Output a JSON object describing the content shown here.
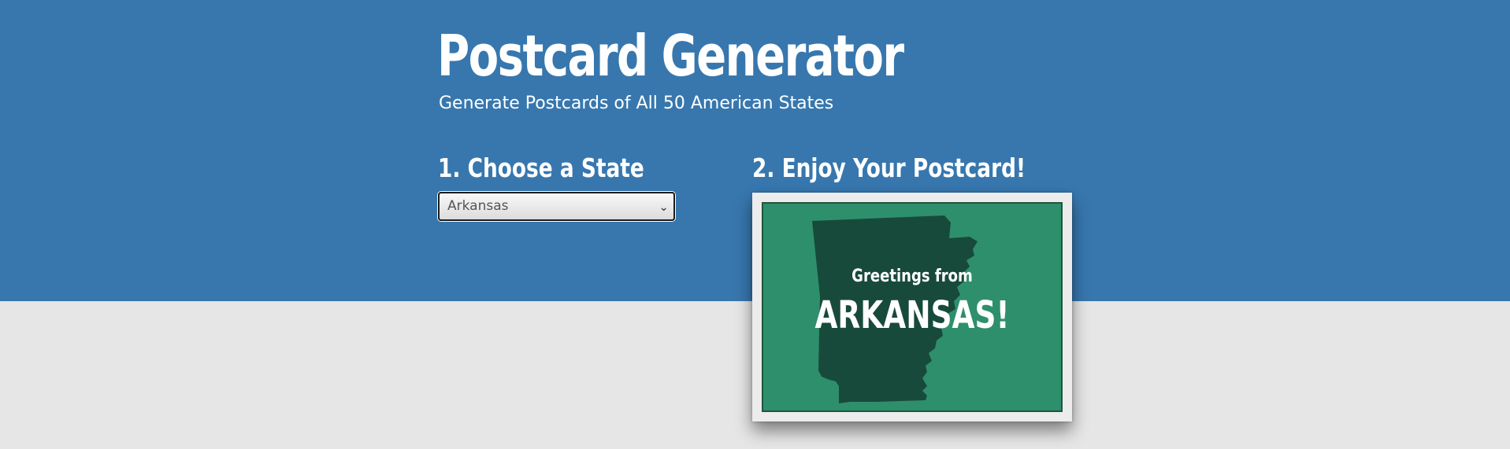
{
  "header": {
    "title": "Postcard Generator",
    "subtitle": "Generate Postcards of All 50 American States"
  },
  "steps": {
    "choose_label": "1. Choose a State",
    "enjoy_label": "2. Enjoy Your Postcard!"
  },
  "state_select": {
    "selected": "Arkansas"
  },
  "postcard": {
    "greeting": "Greetings from",
    "state_text": "ARKANSAS!",
    "state_shape": "arkansas-state-silhouette"
  },
  "colors": {
    "header_bg": "#3777ae",
    "page_bg": "#e6e6e6",
    "card_green": "#2e8f6c",
    "silhouette": "#184a3b"
  }
}
